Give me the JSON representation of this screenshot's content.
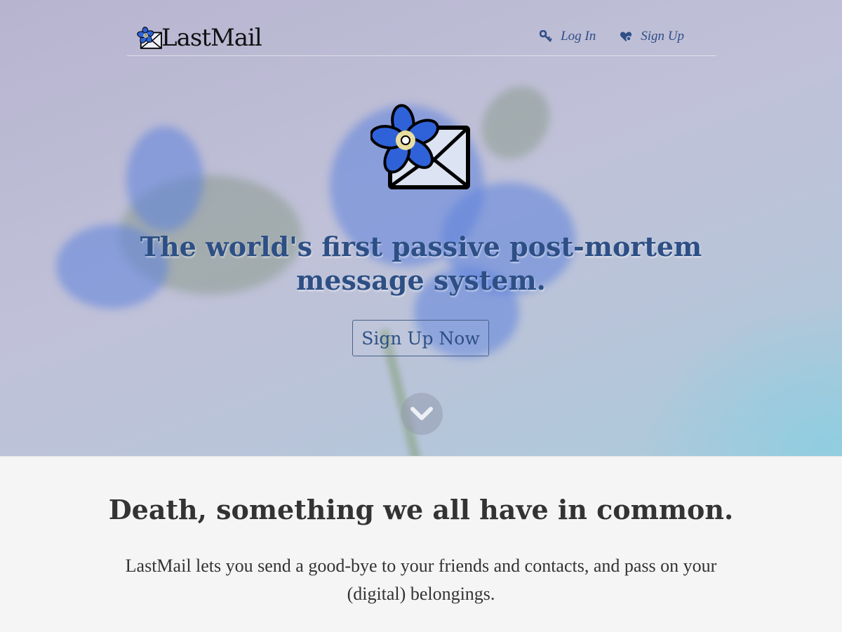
{
  "brand": {
    "name": "LastMail",
    "logo": "forget-me-not-envelope-icon"
  },
  "nav": {
    "login": {
      "label": "Log In",
      "icon": "key-icon"
    },
    "signup": {
      "label": "Sign Up",
      "icon": "heart-icon"
    }
  },
  "hero": {
    "logo": "forget-me-not-envelope-icon",
    "headline": "The world's first passive post-mortem message system.",
    "cta_label": "Sign Up Now",
    "scroll_icon": "chevron-down-icon"
  },
  "intro": {
    "heading": "Death, something we all have in common.",
    "body": "LastMail lets you send a good-bye to your friends and contacts, and pass on your (digital) belongings."
  },
  "colors": {
    "accent": "#2d4f85",
    "petal": "#2f62d8",
    "text": "#333333"
  }
}
